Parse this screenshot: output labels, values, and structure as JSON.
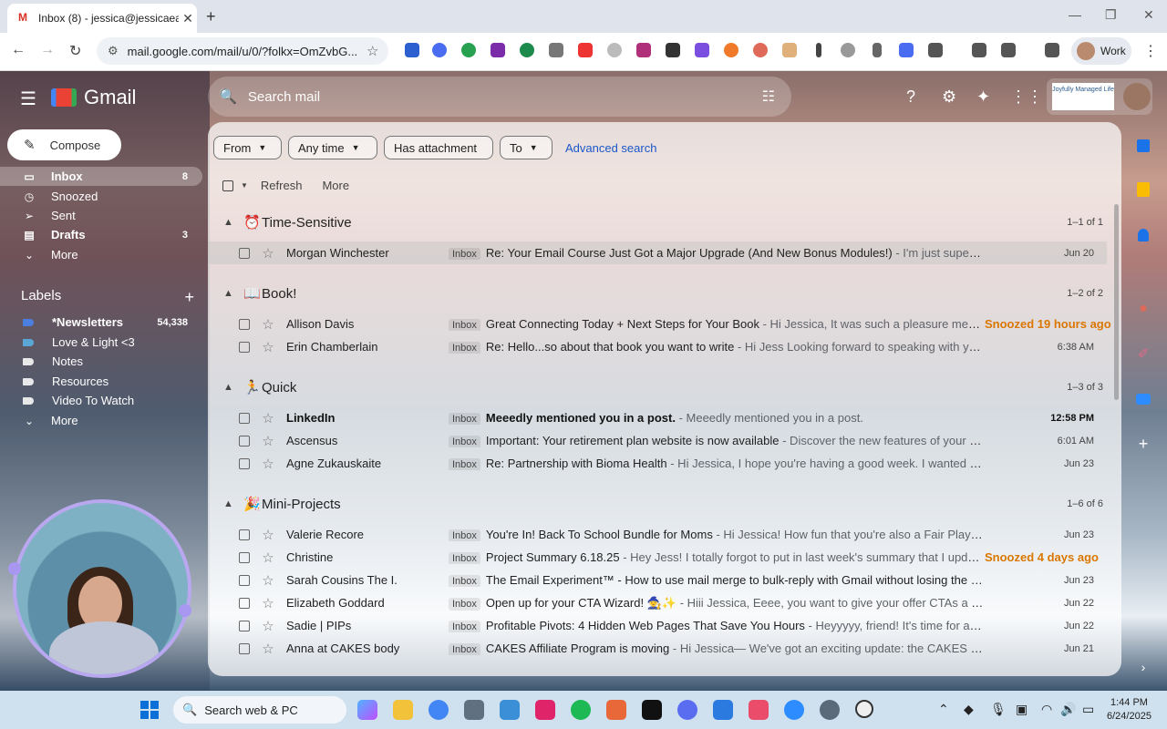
{
  "browser": {
    "tab_title": "Inbox (8) - jessica@jessicaeastman...",
    "url": "mail.google.com/mail/u/0/?folkx=OmZvbG...",
    "profile_label": "Work"
  },
  "gmail": {
    "app_name": "Gmail",
    "search_placeholder": "Search mail",
    "compose_label": "Compose",
    "brand_text": "Joyfully Managed Life"
  },
  "sidebar": {
    "items": [
      {
        "label": "Inbox",
        "count": "8",
        "icon": "inbox-icon"
      },
      {
        "label": "Snoozed",
        "count": "",
        "icon": "clock-icon"
      },
      {
        "label": "Sent",
        "count": "",
        "icon": "send-icon"
      },
      {
        "label": "Drafts",
        "count": "3",
        "icon": "draft-icon"
      },
      {
        "label": "More",
        "count": "",
        "icon": "chevron-down-icon"
      }
    ],
    "labels_heading": "Labels",
    "labels": [
      {
        "label": "*Newsletters",
        "count": "54,338",
        "color": "#4a7fe0"
      },
      {
        "label": "Love & Light <3",
        "count": "",
        "color": "#5aa7d6"
      },
      {
        "label": "Notes",
        "count": "",
        "color": "#e8e8e8"
      },
      {
        "label": "Resources",
        "count": "",
        "color": "#e8e8e8"
      },
      {
        "label": "Video To Watch",
        "count": "",
        "color": "#e8e8e8"
      },
      {
        "label": "More",
        "count": "",
        "color": ""
      }
    ]
  },
  "filters": {
    "from": "From",
    "any_time": "Any time",
    "has_attachment": "Has attachment",
    "to": "To",
    "advanced": "Advanced search"
  },
  "actions": {
    "refresh": "Refresh",
    "more": "More"
  },
  "sections": [
    {
      "title": "Time-Sensitive",
      "emoji": "⏰",
      "count": "1–1 of 1",
      "rows": [
        {
          "from": "Morgan Winchester",
          "badge": "Inbox",
          "subject": "Re: Your Email Course Just Got a Major Upgrade (And New Bonus Modules!)",
          "snippet": " - I'm just super struggling wit...",
          "date": "Jun 20",
          "unread": false,
          "snoozed": false,
          "selected": true
        }
      ]
    },
    {
      "title": "Book!",
      "emoji": "📖",
      "count": "1–2 of 2",
      "rows": [
        {
          "from": "Allison Davis",
          "badge": "Inbox",
          "subject": "Great Connecting Today + Next Steps for Your Book",
          "snippet": " - Hi Jessica, It was such a pleasure meeti...",
          "date": "Snoozed 19 hours ago",
          "unread": false,
          "snoozed": true,
          "selected": false
        },
        {
          "from": "Erin Chamberlain",
          "badge": "Inbox",
          "subject": "Re: Hello...so about that book you want to write",
          "snippet": " - Hi Jess Looking forward to speaking with you on Thursda...",
          "date": "6:38 AM",
          "unread": false,
          "snoozed": false,
          "selected": false
        }
      ]
    },
    {
      "title": "Quick",
      "emoji": "🏃",
      "count": "1–3 of 3",
      "rows": [
        {
          "from": "LinkedIn",
          "badge": "Inbox",
          "subject": "Meeedly mentioned you in a post.",
          "snippet": " - Meeedly mentioned you in a post.",
          "date": "12:58 PM",
          "unread": true,
          "snoozed": false,
          "selected": false
        },
        {
          "from": "Ascensus",
          "badge": "Inbox",
          "subject": "Important: Your retirement plan website is now available",
          "snippet": " - Discover the new features of your enhanced onli...",
          "date": "6:01 AM",
          "unread": false,
          "snoozed": false,
          "selected": false
        },
        {
          "from": "Agne Zukauskaite",
          "badge": "Inbox",
          "subject": "Re: Partnership with Bioma Health",
          "snippet": " - Hi Jessica, I hope you're having a good week. I wanted to follow up an...",
          "date": "Jun 23",
          "unread": false,
          "snoozed": false,
          "selected": false
        }
      ]
    },
    {
      "title": "Mini-Projects",
      "emoji": "🎉",
      "count": "1–6 of 6",
      "rows": [
        {
          "from": "Valerie Recore",
          "badge": "Inbox",
          "subject": "You're In! Back To School Bundle for Moms",
          "snippet": " - Hi Jessica! How fun that you're also a Fair Play facilitator! Ma...",
          "date": "Jun 23",
          "unread": false,
          "snoozed": false,
          "selected": false
        },
        {
          "from": "Christine",
          "badge": "Inbox",
          "subject": "Project Summary 6.18.25",
          "snippet": " - Hey Jess! I totally forgot to put in last week's summary that I updated...",
          "date": "Snoozed 4 days ago",
          "unread": false,
          "snoozed": true,
          "selected": false
        },
        {
          "from": "Sarah Cousins The I.",
          "badge": "Inbox",
          "subject": "The Email Experiment™ - How to use mail merge to bulk-reply with Gmail without losing the personal touch",
          "snippet": " -",
          "date": "Jun 23",
          "unread": false,
          "snoozed": false,
          "selected": false
        },
        {
          "from": "Elizabeth Goddard",
          "badge": "Inbox",
          "subject": "Open up for your CTA Wizard! 🧙✨",
          "snippet": " - Hiii Jessica, Eeee, you want to give your offer CTAs a magical boost! ...",
          "date": "Jun 22",
          "unread": false,
          "snoozed": false,
          "selected": false
        },
        {
          "from": "Sadie | PIPs",
          "badge": "Inbox",
          "subject": "Profitable Pivots: 4 Hidden Web Pages That Save You Hours",
          "snippet": " - Heyyyyy, friend! It's time for another Profitab...",
          "date": "Jun 22",
          "unread": false,
          "snoozed": false,
          "selected": false
        },
        {
          "from": "Anna at CAKES body",
          "badge": "Inbox",
          "subject": "CAKES Affiliate Program is moving",
          "snippet": " - Hi Jessica— We've got an exciting update: the CAKES Hype Girls affili...",
          "date": "Jun 21",
          "unread": false,
          "snoozed": false,
          "selected": false
        }
      ]
    }
  ],
  "taskbar": {
    "search_label": "Search web & PC",
    "time": "1:44 PM",
    "date": "6/24/2025"
  },
  "colors": {
    "accent": "#1a57c9",
    "snooze": "#d97700"
  }
}
